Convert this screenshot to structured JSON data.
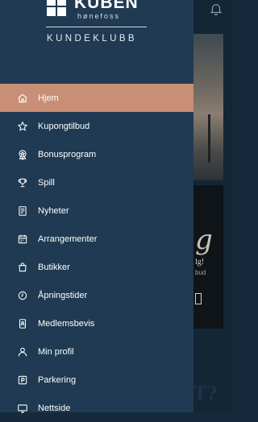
{
  "app": {
    "logo_text": "KUBEN",
    "logo_sub": "hønefoss",
    "club_title": "KUNDEKLUBB"
  },
  "menu": [
    {
      "label": "Hjem",
      "icon": "home-icon",
      "active": true
    },
    {
      "label": "Kupongtilbud",
      "icon": "star-icon"
    },
    {
      "label": "Bonusprogram",
      "icon": "award-icon"
    },
    {
      "label": "Spill",
      "icon": "trophy-icon"
    },
    {
      "label": "Nyheter",
      "icon": "news-icon"
    },
    {
      "label": "Arrangementer",
      "icon": "calendar-icon"
    },
    {
      "label": "Butikker",
      "icon": "shopping-bag-icon"
    },
    {
      "label": "Åpningstider",
      "icon": "clock-icon"
    },
    {
      "label": "Medlemsbevis",
      "icon": "id-card-icon"
    },
    {
      "label": "Min profil",
      "icon": "user-icon"
    },
    {
      "label": "Parkering",
      "icon": "parking-icon"
    },
    {
      "label": "Nettside",
      "icon": "monitor-icon"
    }
  ],
  "background": {
    "script_text": "g",
    "line1": "lg!",
    "line2": "bud",
    "big_text": "T?"
  },
  "colors": {
    "drawer_bg": "#1f3a52",
    "active_bg": "#c98f76",
    "background_bg": "#132636"
  }
}
